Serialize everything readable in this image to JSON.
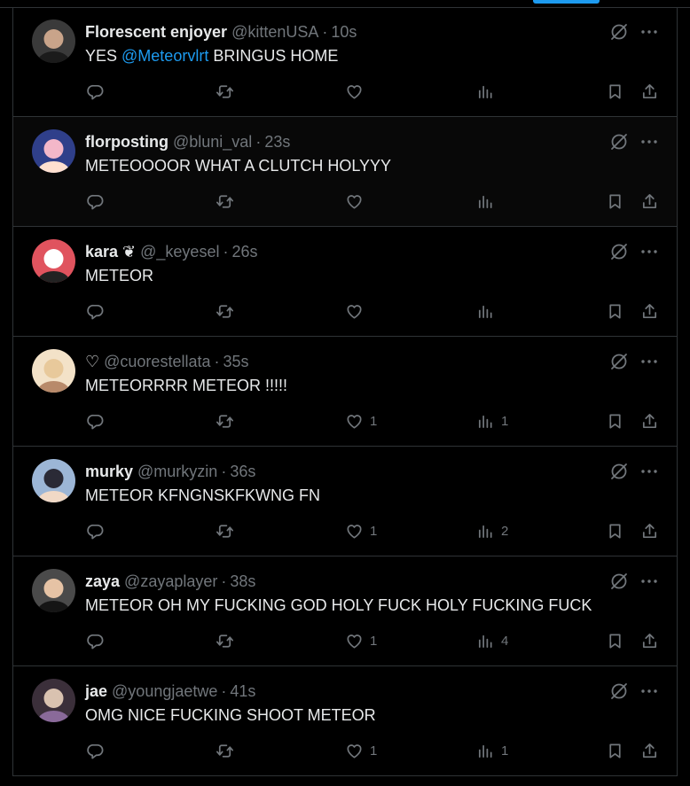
{
  "tweets": [
    {
      "name": "Florescent enjoyer",
      "badge": "",
      "handle": "@kittenUSA",
      "time": "10s",
      "text_before": "YES ",
      "mention": "@Meteorvlrt",
      "text_after": " BRINGUS HOME",
      "likes": "",
      "views": "",
      "avatar_colors": [
        "#3a3a3a",
        "#c9a48a",
        "#1b1b1b"
      ]
    },
    {
      "name": "florposting",
      "badge": "",
      "handle": "@bluni_val",
      "time": "23s",
      "text_before": "METEOOOOR WHAT A CLUTCH HOLYYY",
      "mention": "",
      "text_after": "",
      "likes": "",
      "views": "",
      "avatar_colors": [
        "#2f3f8a",
        "#f3b7c9",
        "#ffe0d0"
      ]
    },
    {
      "name": "kara",
      "badge": "❦",
      "handle": "@_keyesel",
      "time": "26s",
      "text_before": "METEOR",
      "mention": "",
      "text_after": "",
      "likes": "",
      "views": "",
      "avatar_colors": [
        "#e0535e",
        "#ffffff",
        "#222222"
      ]
    },
    {
      "name": "",
      "badge": "♡",
      "handle": "@cuorestellata",
      "time": "35s",
      "text_before": "METEORRRR METEOR !!!!!",
      "mention": "",
      "text_after": "",
      "likes": "1",
      "views": "1",
      "avatar_colors": [
        "#f3e2c8",
        "#e8c99b",
        "#b88a6a"
      ]
    },
    {
      "name": "murky",
      "badge": "",
      "handle": "@murkyzin",
      "time": "36s",
      "text_before": "METEOR KFNGNSKFKWNG FN",
      "mention": "",
      "text_after": "",
      "likes": "1",
      "views": "2",
      "avatar_colors": [
        "#9cb6d6",
        "#2a2a36",
        "#f1d9c6"
      ]
    },
    {
      "name": "zaya",
      "badge": "",
      "handle": "@zayaplayer",
      "time": "38s",
      "text_before": "METEOR OH MY FUCKING GOD HOLY FUCK HOLY FUCKING FUCK",
      "mention": "",
      "text_after": "",
      "likes": "1",
      "views": "4",
      "avatar_colors": [
        "#4a4a4a",
        "#e6c3a5",
        "#151515"
      ]
    },
    {
      "name": "jae",
      "badge": "",
      "handle": "@youngjaetwe",
      "time": "41s",
      "text_before": "OMG NICE FUCKING SHOOT METEOR",
      "mention": "",
      "text_after": "",
      "likes": "1",
      "views": "1",
      "avatar_colors": [
        "#3b2f3a",
        "#d9c2b0",
        "#8a6a9a"
      ]
    }
  ],
  "colors": {
    "accent": "#1d9bf0",
    "muted": "#71767b",
    "text": "#e7e9ea",
    "border": "#2f3336"
  }
}
